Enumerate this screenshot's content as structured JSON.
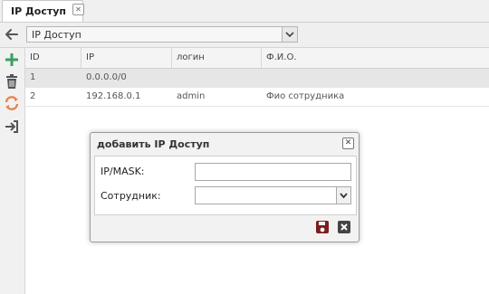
{
  "tab": {
    "label": "IP Доступ"
  },
  "toolbar": {
    "select_value": "IP Доступ"
  },
  "grid": {
    "columns": [
      "ID",
      "IP",
      "логин",
      "Ф.И.О."
    ],
    "rows": [
      {
        "id": "1",
        "ip": "0.0.0.0/0",
        "login": "",
        "fio": ""
      },
      {
        "id": "2",
        "ip": "192.168.0.1",
        "login": "admin",
        "fio": "Фио сотрудника"
      }
    ]
  },
  "dialog": {
    "title": "добавить IP Доступ",
    "ipmask_label": "IP/MASK:",
    "ipmask_value": "",
    "employee_label": "Сотрудник:",
    "employee_value": ""
  },
  "icons": {
    "back": "arrow-left-icon",
    "add": "plus-icon",
    "delete": "trash-icon",
    "refresh": "refresh-icon",
    "login": "sign-in-icon",
    "save": "floppy-icon",
    "cancel": "close-icon"
  },
  "colors": {
    "add": "#3aa05a",
    "refresh": "#e8834a",
    "save": "#7a1f1f"
  }
}
